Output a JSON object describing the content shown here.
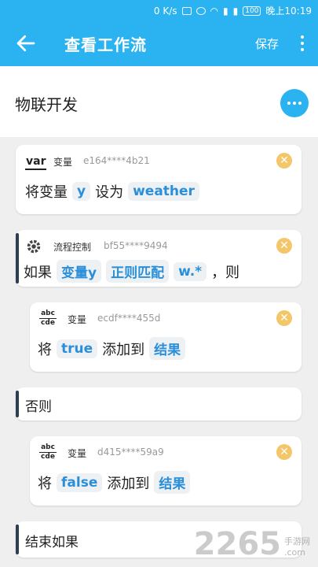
{
  "status_bar": {
    "speed": "0 K/s",
    "battery": "100",
    "time": "晚上10:19"
  },
  "app_bar": {
    "title": "查看工作流",
    "save_label": "保存"
  },
  "workflow": {
    "name": "物联开发"
  },
  "blocks": [
    {
      "type_label": "变量",
      "code": "e164****4b21",
      "icon": "var-icon",
      "icon_text": "var",
      "line": {
        "pre": "将变量",
        "chip1": "y",
        "mid": "设为",
        "chip2": "weather"
      }
    },
    {
      "type_label": "流程控制",
      "code": "bf55****9494",
      "icon": "gear-icon",
      "line": {
        "pre": "如果",
        "chip1": "变量y",
        "chip2": "正则匹配",
        "chip3": "w.*",
        "post": "，则"
      }
    },
    {
      "type_label": "变量",
      "code": "ecdf****455d",
      "icon": "abc-cde-icon",
      "icon_top": "abc",
      "icon_bottom": "cde",
      "line": {
        "pre": "将",
        "chip1": "true",
        "mid": "添加到",
        "chip2": "结果"
      }
    },
    {
      "text": "否则"
    },
    {
      "type_label": "变量",
      "code": "d415****59a9",
      "icon": "abc-cde-icon",
      "icon_top": "abc",
      "icon_bottom": "cde",
      "line": {
        "pre": "将",
        "chip1": "false",
        "mid": "添加到",
        "chip2": "结果"
      }
    },
    {
      "text": "结束如果"
    }
  ],
  "watermark": {
    "number": "2265",
    "suffix_top": "手游网",
    "suffix_bottom": ".com"
  },
  "colors": {
    "primary": "#2ab3f0",
    "chip_text": "#2a8fd8",
    "close": "#f3c66a"
  }
}
